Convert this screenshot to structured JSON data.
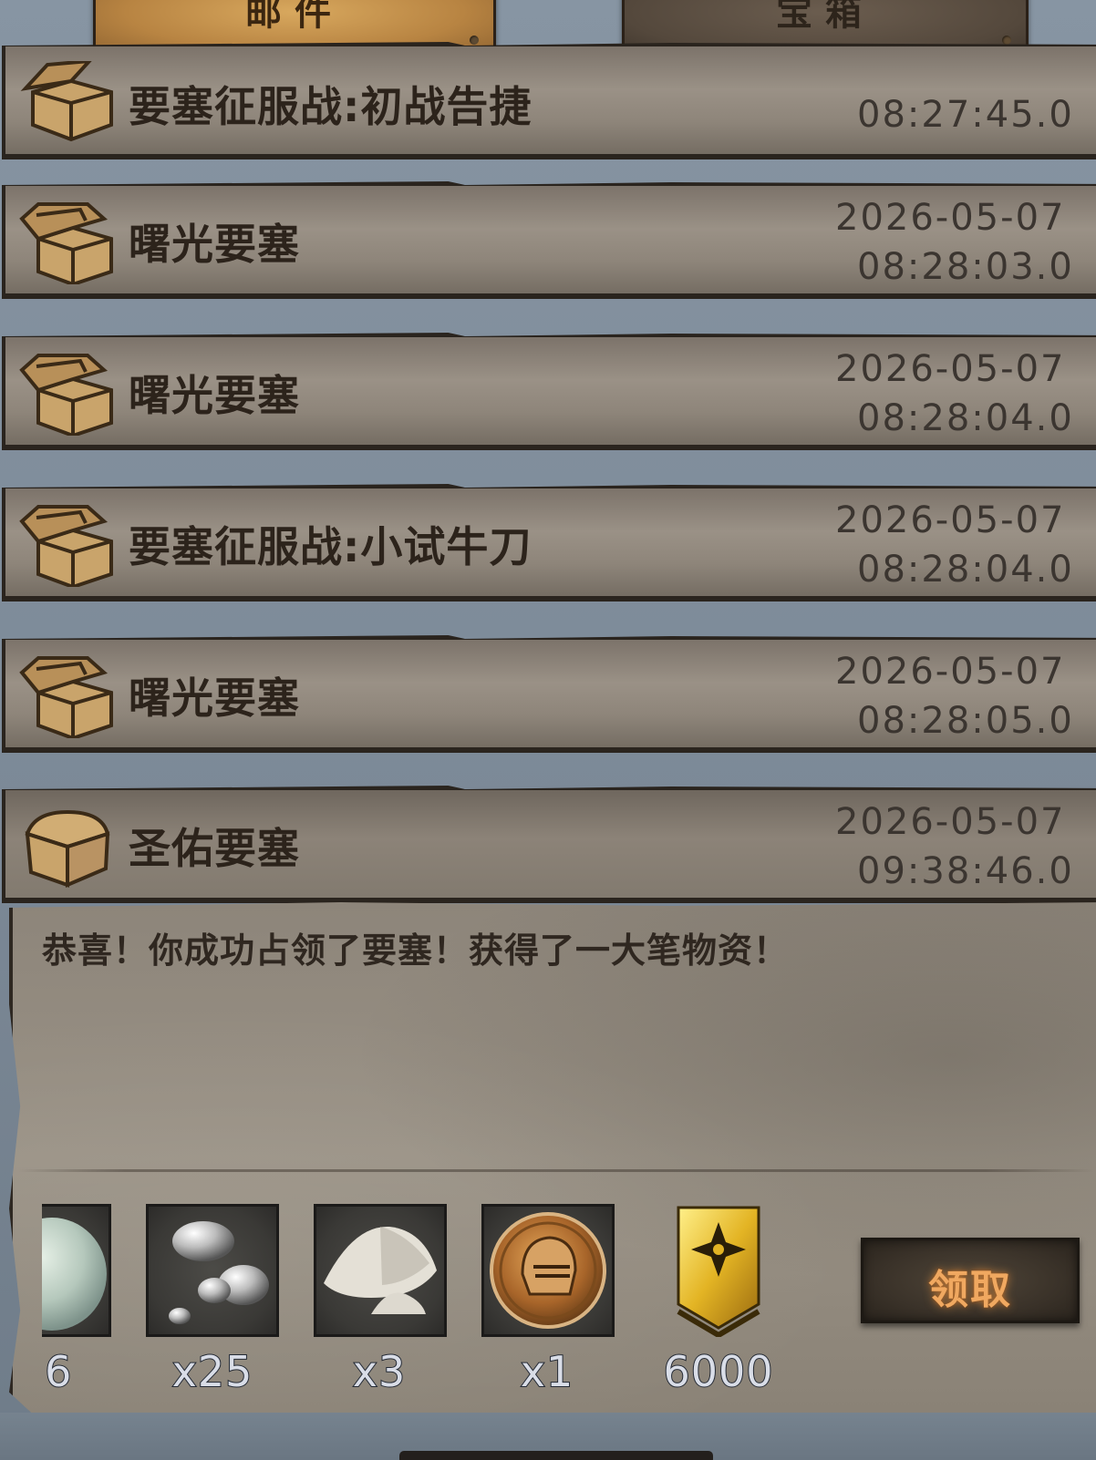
{
  "tabs": [
    {
      "label": "邮件",
      "active": true
    },
    {
      "label": "宝箱",
      "active": false
    }
  ],
  "mails": [
    {
      "title": "要塞征服战:初战告捷",
      "date": "",
      "time": "08:27:45.0",
      "icon": "open-chest-icon"
    },
    {
      "title": "曙光要塞",
      "date": "2026-05-07",
      "time": "08:28:03.0",
      "icon": "open-chest-icon"
    },
    {
      "title": "曙光要塞",
      "date": "2026-05-07",
      "time": "08:28:04.0",
      "icon": "open-chest-icon"
    },
    {
      "title": "要塞征服战:小试牛刀",
      "date": "2026-05-07",
      "time": "08:28:04.0",
      "icon": "open-chest-icon"
    },
    {
      "title": "曙光要塞",
      "date": "2026-05-07",
      "time": "08:28:05.0",
      "icon": "open-chest-icon"
    },
    {
      "title": "圣佑要塞",
      "date": "2026-05-07",
      "time": "09:38:46.0",
      "icon": "closed-chest-icon"
    }
  ],
  "open_mail": {
    "message": "恭喜！你成功占领了要塞！获得了一大笔物资！",
    "rewards": [
      {
        "icon": "crystal-orb-icon",
        "qty": ":6"
      },
      {
        "icon": "silver-pebbles-icon",
        "qty": "x25"
      },
      {
        "icon": "salt-pile-icon",
        "qty": "x3"
      },
      {
        "icon": "knight-helmet-medal-icon",
        "qty": "x1"
      },
      {
        "icon": "gold-cross-banner-icon",
        "qty": "6000"
      }
    ],
    "claim_label": "领取"
  },
  "colors": {
    "background": "#7c8997",
    "parchment": "#9a9186",
    "mail_tab_active": "#c8964c",
    "claim_text": "#f0a860",
    "reward_qty": "#d9dde7"
  }
}
